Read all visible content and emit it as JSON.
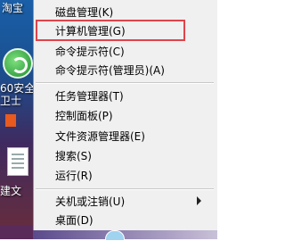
{
  "desktop": {
    "labels": [
      {
        "id": "top",
        "text": "淘宝"
      },
      {
        "id": "360",
        "text": "60安全"
      },
      {
        "id": "360b",
        "text": "卫士"
      },
      {
        "id": "doc",
        "text": "建文"
      }
    ]
  },
  "menu": {
    "items": [
      {
        "label": "磁盘管理(K)"
      },
      {
        "label": "计算机管理(G)",
        "highlighted": true
      },
      {
        "label": "命令提示符(C)"
      },
      {
        "label": "命令提示符(管理员)(A)"
      },
      {
        "label": "任务管理器(T)"
      },
      {
        "label": "控制面板(P)"
      },
      {
        "label": "文件资源管理器(E)"
      },
      {
        "label": "搜索(S)"
      },
      {
        "label": "运行(R)"
      },
      {
        "label": "关机或注销(U)",
        "submenu": true
      },
      {
        "label": "桌面(D)"
      }
    ]
  },
  "colors": {
    "highlight_border": "#e0444a",
    "menu_background": "#f0f0f0"
  }
}
